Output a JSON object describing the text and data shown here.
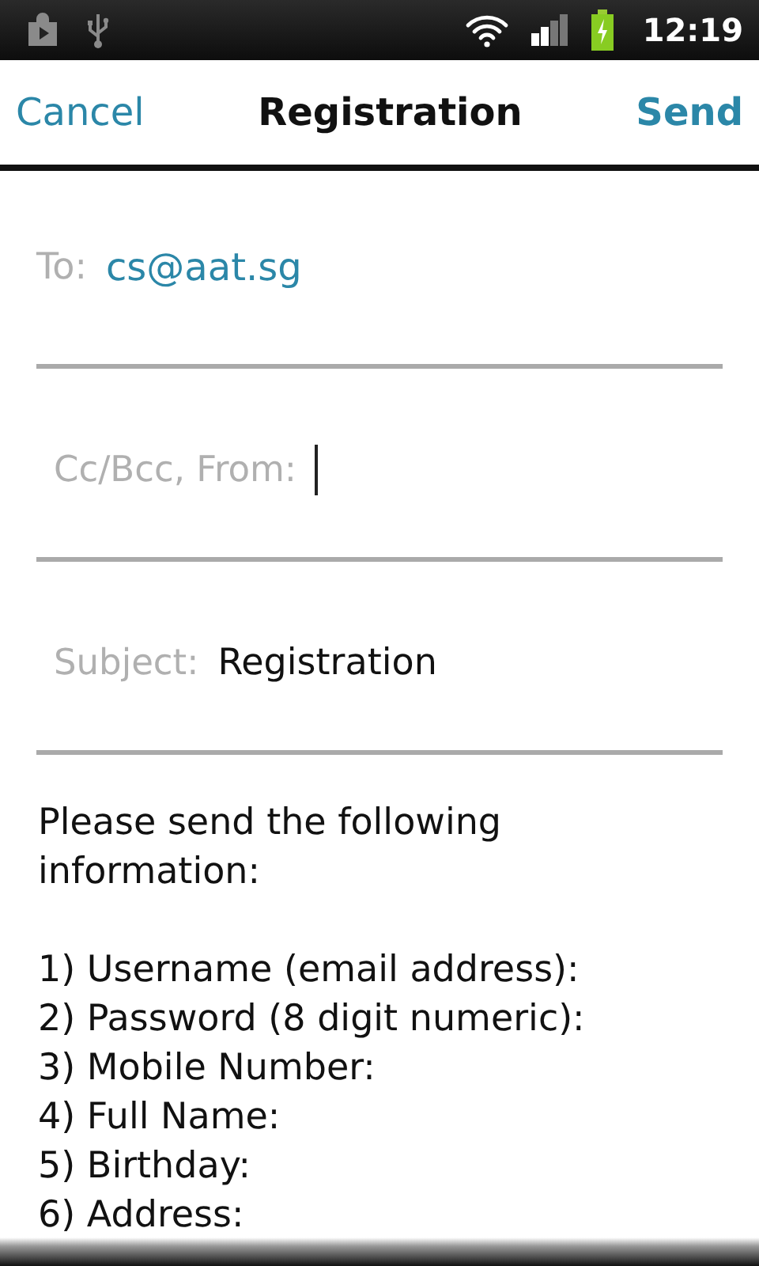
{
  "status_bar": {
    "time": "12:19"
  },
  "header": {
    "cancel": "Cancel",
    "title": "Registration",
    "send": "Send"
  },
  "fields": [
    {
      "label": "To:",
      "value": "cs@aat.sg",
      "kind": "recipient",
      "focused": false
    },
    {
      "label": "Cc/Bcc, From:",
      "kind": "text",
      "focused": true
    },
    {
      "label": "Subject:",
      "value": "Registration",
      "kind": "text",
      "focused": false
    }
  ],
  "body": {
    "intro": "Please send the following information:",
    "lines": [
      "1) Username (email address):",
      "2) Password (8 digit numeric):",
      "3) Mobile Number:",
      "4) Full Name:",
      "5) Birthday:",
      "6) Address:"
    ]
  }
}
